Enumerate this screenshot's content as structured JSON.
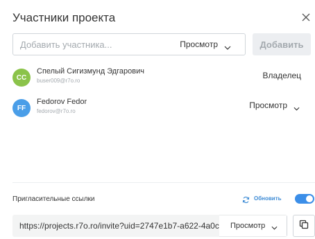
{
  "dialog": {
    "title": "Участники проекта"
  },
  "add_member": {
    "placeholder": "Добавить участника...",
    "role_label": "Просмотр",
    "add_button_label": "Добавить"
  },
  "members": [
    {
      "initials": "СС",
      "avatar_color": "#8bc34a",
      "name": "Спелый Сигизмунд Эдгарович",
      "email": "buser009@r7o.ro",
      "role": "Владелец"
    },
    {
      "initials": "FF",
      "avatar_color": "#4a9ee8",
      "name": "Fedorov Fedor",
      "email": "fedorov@r7o.ro",
      "role": "Просмотр"
    }
  ],
  "invite_links": {
    "label": "Пригласительные ссылки",
    "refresh_label": "Обновить",
    "enabled": true,
    "url": "https://projects.r7o.ro/invite?uid=2747e1b7-a622-4a0c",
    "role_label": "Просмотр"
  },
  "colors": {
    "accent": "#3b8ee8",
    "link_blue": "#3d8bd5",
    "muted": "#a3a9ae"
  },
  "icons": {
    "close": "close-icon",
    "chevron": "chevron-down-icon",
    "refresh": "refresh-icon",
    "copy": "copy-icon"
  }
}
